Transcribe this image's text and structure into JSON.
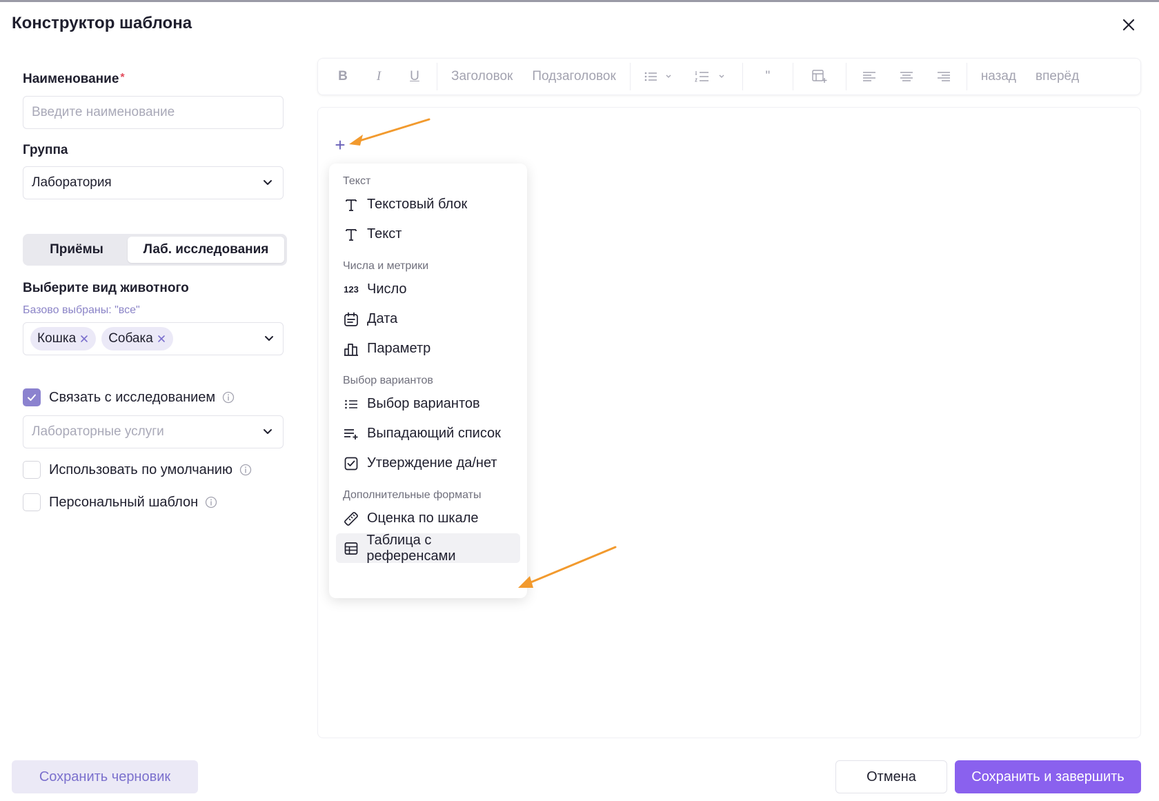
{
  "modal": {
    "title": "Конструктор шаблона"
  },
  "form": {
    "name_label": "Наименование",
    "name_required": "*",
    "name_placeholder": "Введите наименование",
    "name_value": "",
    "group_label": "Группа",
    "group_value": "Лаборатория",
    "segments": [
      {
        "label": "Приёмы",
        "active": false
      },
      {
        "label": "Лаб. исследования",
        "active": true
      }
    ],
    "animal_label": "Выберите вид животного",
    "animal_hint": "Базово выбраны: \"все\"",
    "animal_tags": [
      "Кошка",
      "Собака"
    ],
    "link_research_label": "Связать с исследованием",
    "link_research_checked": true,
    "lab_services_placeholder": "Лабораторные услуги",
    "default_label": "Использовать по умолчанию",
    "default_checked": false,
    "personal_label": "Персональный шаблон",
    "personal_checked": false
  },
  "toolbar": {
    "bold": "B",
    "italic": "I",
    "underline": "U",
    "heading": "Заголовок",
    "subheading": "Подзаголовок",
    "quote": "\"",
    "back": "назад",
    "forward": "вперёд"
  },
  "editor": {
    "plus": "+"
  },
  "menu": {
    "groups": [
      {
        "title": "Текст",
        "items": [
          {
            "label": "Текстовый блок",
            "icon": "text-t-icon"
          },
          {
            "label": "Текст",
            "icon": "text-t-icon"
          }
        ]
      },
      {
        "title": "Числа и метрики",
        "items": [
          {
            "label": "Число",
            "icon": "number-123-icon",
            "glyph": "123"
          },
          {
            "label": "Дата",
            "icon": "calendar-icon"
          },
          {
            "label": "Параметр",
            "icon": "bar-chart-icon"
          }
        ]
      },
      {
        "title": "Выбор вариантов",
        "items": [
          {
            "label": "Выбор вариантов",
            "icon": "list-icon"
          },
          {
            "label": "Выпадающий список",
            "icon": "list-add-icon"
          },
          {
            "label": "Утверждение да/нет",
            "icon": "checkbox-icon"
          }
        ]
      },
      {
        "title": "Дополнительные форматы",
        "items": [
          {
            "label": "Оценка по шкале",
            "icon": "ruler-icon"
          },
          {
            "label": "Таблица с референсами",
            "icon": "table-icon",
            "highlighted": true
          }
        ]
      }
    ]
  },
  "footer": {
    "draft": "Сохранить черновик",
    "cancel": "Отмена",
    "save": "Сохранить и завершить"
  },
  "colors": {
    "accent": "#8a61ee",
    "accent_light": "#ebe9f6",
    "arrow": "#f29a2e",
    "plus": "#6a61b8"
  }
}
